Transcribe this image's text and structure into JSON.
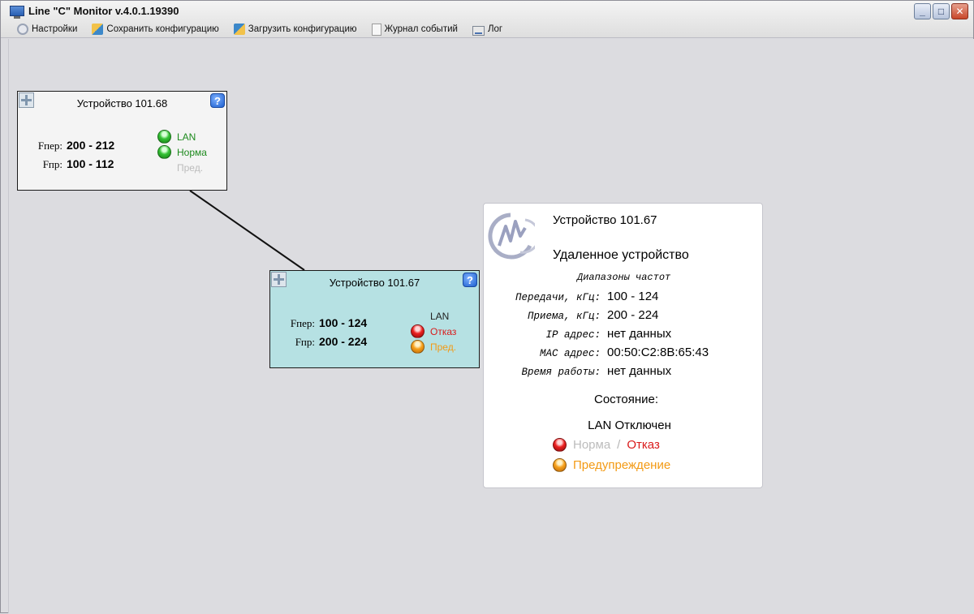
{
  "window": {
    "title": "Line \"C\" Monitor v.4.0.1.19390",
    "controls": [
      "_",
      "□",
      "✕"
    ]
  },
  "toolbar": {
    "items": [
      {
        "label": "Настройки",
        "icon": "settings-icon"
      },
      {
        "label": "Сохранить конфигурацию",
        "icon": "save-config-icon"
      },
      {
        "label": "Загрузить конфигурацию",
        "icon": "load-config-icon"
      },
      {
        "label": "Журнал событий",
        "icon": "event-journal-icon"
      },
      {
        "label": "Лог",
        "icon": "log-icon"
      }
    ]
  },
  "devices": [
    {
      "title": "Устройство 101.68",
      "help": "?",
      "ftx_label": "Fпер:",
      "ftx_value": "200 - 212",
      "frx_label": "Fпр:",
      "frx_value": "100 - 112",
      "status": [
        {
          "label": "LAN",
          "led": "green",
          "color": "#1d8a1d"
        },
        {
          "label": "Норма",
          "led": "green",
          "color": "#1d8a1d"
        },
        {
          "label": "Пред.",
          "led": "none",
          "color": "#bcbcbc"
        }
      ],
      "background": "#f4f4f4"
    },
    {
      "title": "Устройство 101.67",
      "help": "?",
      "ftx_label": "Fпер:",
      "ftx_value": "100 - 124",
      "frx_label": "Fпр:",
      "frx_value": "200 - 224",
      "status": [
        {
          "label": "LAN",
          "led": "none",
          "color": "#222222"
        },
        {
          "label": "Отказ",
          "led": "red",
          "color": "#d91b1b"
        },
        {
          "label": "Пред.",
          "led": "orange",
          "color": "#f39a14"
        }
      ],
      "background": "#b6e1e3"
    }
  ],
  "info": {
    "title": "Устройство 101.67",
    "role": "Удаленное устройство",
    "subheading": "Диапазоны частот",
    "rows": [
      {
        "label": "Передачи, кГц:",
        "value": "100 - 124"
      },
      {
        "label": "Приема, кГц:",
        "value": "200 - 224"
      },
      {
        "label": "IP адрес:",
        "value": "нет данных"
      },
      {
        "label": "MAC адрес:",
        "value": "00:50:C2:8B:65:43"
      },
      {
        "label": "Время работы:",
        "value": "нет данных"
      }
    ],
    "state_title": "Состояние:",
    "lan_state": "LAN Отключен",
    "norm_label": "Норма",
    "separator": "/",
    "fail_label": "Отказ",
    "warn_label": "Предупреждение"
  },
  "colors": {
    "ok": "#1d8a1d",
    "fail": "#d91b1b",
    "warn": "#f39a14",
    "inactive": "#bcbcbc",
    "remote_device_bg": "#b6e1e3",
    "canvas_bg": "#dcdce0"
  }
}
